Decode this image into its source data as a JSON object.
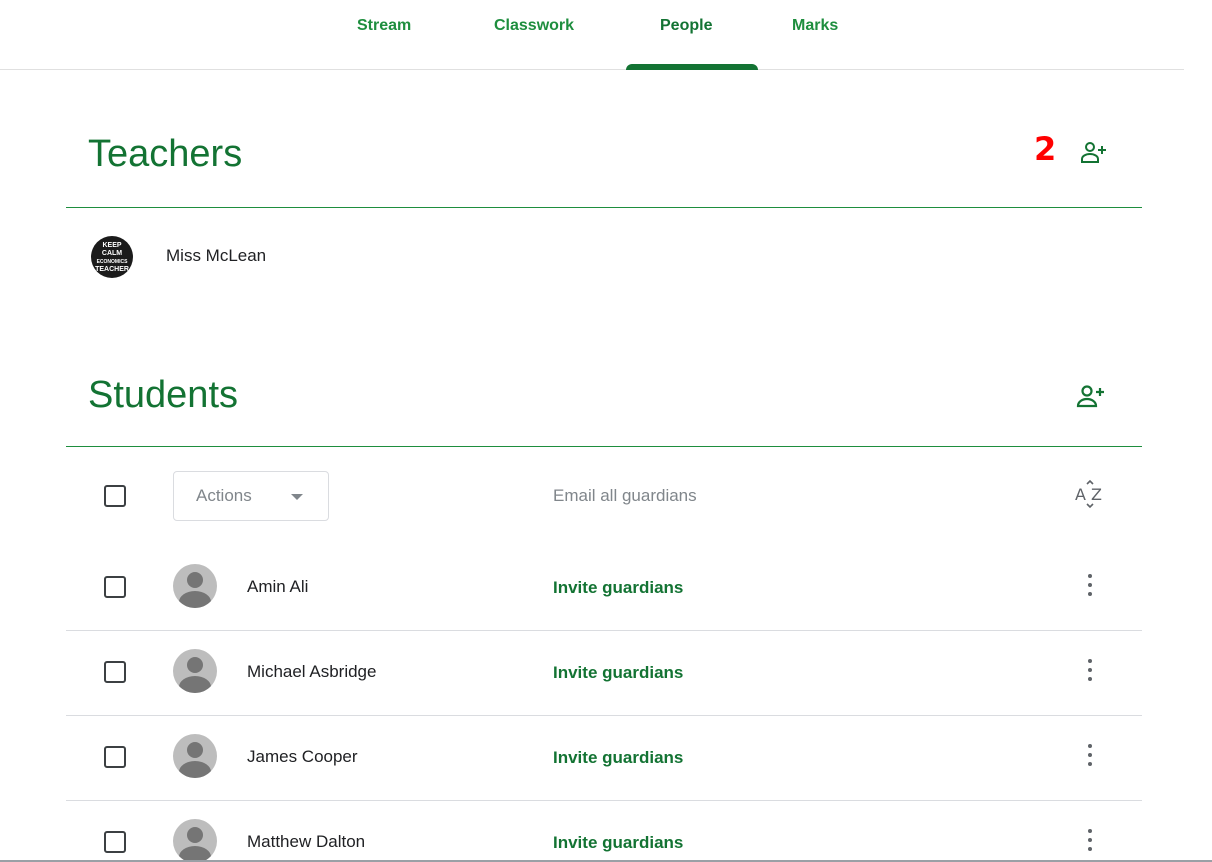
{
  "nav": {
    "tabs": [
      {
        "label": "Stream"
      },
      {
        "label": "Classwork"
      },
      {
        "label": "People",
        "active": true
      },
      {
        "label": "Marks"
      }
    ]
  },
  "teachers": {
    "title": "Teachers",
    "count": "2",
    "add_icon": "person-add-outline-icon",
    "list": [
      {
        "name": "Miss McLean",
        "avatar_text": [
          "KEEP",
          "CALM",
          "ECONOMICS",
          "TEACHER"
        ]
      }
    ]
  },
  "students": {
    "title": "Students",
    "add_icon": "person-add-icon",
    "toolbar": {
      "actions_label": "Actions",
      "email_all_label": "Email all guardians",
      "sort_icon": "sort-az-icon"
    },
    "list": [
      {
        "name": "Amin Ali",
        "invite_label": "Invite guardians"
      },
      {
        "name": "Michael Asbridge",
        "invite_label": "Invite guardians"
      },
      {
        "name": "James Cooper",
        "invite_label": "Invite guardians"
      },
      {
        "name": "Matthew Dalton",
        "invite_label": "Invite guardians"
      }
    ]
  },
  "colors": {
    "accent": "#137333",
    "tab_text": "#1e8e3e",
    "badge": "#ff0000",
    "muted": "#80868b"
  }
}
